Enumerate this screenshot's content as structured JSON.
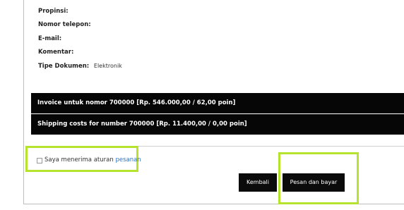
{
  "fields": [
    {
      "label": "Propinsi:",
      "value": ""
    },
    {
      "label": "Nomor telepon:",
      "value": ""
    },
    {
      "label": "E-mail:",
      "value": ""
    },
    {
      "label": "Komentar:",
      "value": ""
    },
    {
      "label": "Tipe Dokumen:",
      "value": "Elektronik"
    }
  ],
  "invoice": {
    "invoice_text": "Invoice untuk nomor 700000 [Rp. 546.000,00 / 62,00 poin]",
    "shipping_text": "Shipping costs for number 700000 [Rp. 11.400,00 / 0,00 poin]"
  },
  "terms": {
    "text": "Saya menerima aturan",
    "link": "pesanan",
    "checked": false
  },
  "buttons": {
    "back": "Kembali",
    "order": "Pesan dan bayar"
  },
  "colors": {
    "highlight": "#b6e32d",
    "link": "#2d72c4",
    "bar": "#060606"
  }
}
